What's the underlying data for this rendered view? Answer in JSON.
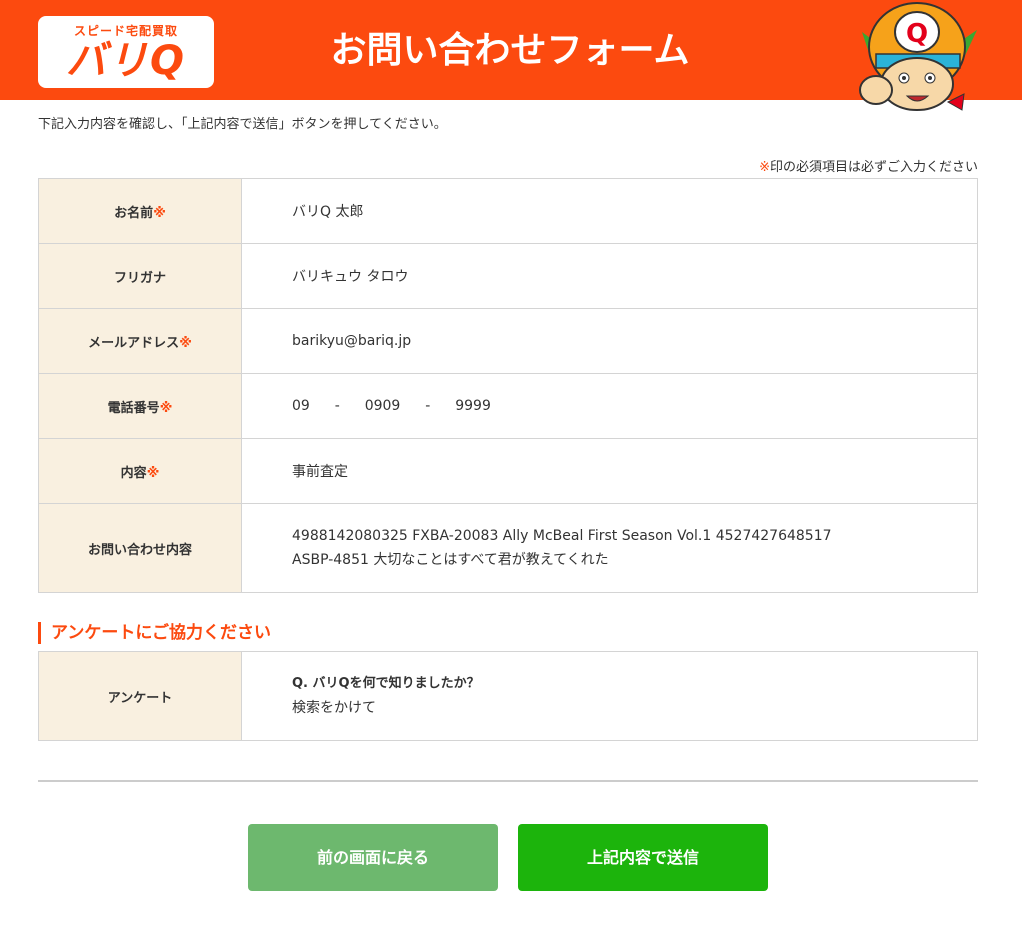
{
  "header": {
    "logo_sub": "スピード宅配買取",
    "logo_main": "バリQ",
    "title": "お問い合わせフォーム",
    "bg_color": "#fc4a0f"
  },
  "intro": "下記入力内容を確認し、「上記内容で送信」ボタンを押してください。",
  "required_note": {
    "mark": "※",
    "text": "印の必須項目は必ずご入力ください"
  },
  "form": {
    "name": {
      "label": "お名前",
      "required": "※",
      "value": "バリQ 太郎"
    },
    "furigana": {
      "label": "フリガナ",
      "value": "バリキュウ タロウ"
    },
    "email": {
      "label": "メールアドレス",
      "required": "※",
      "value": "barikyu@bariq.jp"
    },
    "phone": {
      "label": "電話番号",
      "required": "※",
      "part1": "09",
      "sep1": "-",
      "part2": "0909",
      "sep2": "-",
      "part3": "9999"
    },
    "subject": {
      "label": "内容",
      "required": "※",
      "value": "事前査定"
    },
    "inquiry": {
      "label": "お問い合わせ内容",
      "line1": "4988142080325 FXBA-20083 Ally McBeal First Season Vol.1 4527427648517",
      "line2": "ASBP-4851 大切なことはすべて君が教えてくれた"
    }
  },
  "survey": {
    "heading": "アンケートにご協力ください",
    "label": "アンケート",
    "question": "Q. バリQを何で知りましたか？",
    "answer": "検索をかけて"
  },
  "buttons": {
    "back": "前の画面に戻る",
    "submit": "上記内容で送信",
    "back_color": "#6db86e",
    "submit_color": "#1cb40c"
  }
}
